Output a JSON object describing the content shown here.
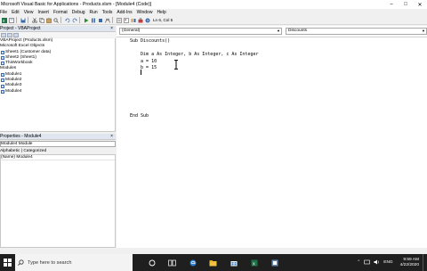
{
  "window": {
    "title": "Microsoft Visual Basic for Applications - Products.xlsm - [Module4 (Code)]",
    "controls": [
      "–",
      "□",
      "✕"
    ]
  },
  "menu": [
    "File",
    "Edit",
    "View",
    "Insert",
    "Format",
    "Debug",
    "Run",
    "Tools",
    "Add-Ins",
    "Window",
    "Help"
  ],
  "toolbar": {
    "position": "Ln 6, Col 5"
  },
  "project_pane": {
    "title": "Project - VBAProject",
    "close": "×",
    "tree": [
      "VBAProject (Products.xlsm)",
      "Microsoft Excel Objects",
      "Sheet1 (Customer data)",
      "Sheet2 (Sheet1)",
      "ThisWorkbook",
      "Modules",
      "Module1",
      "Module2",
      "Module3",
      "Module4"
    ]
  },
  "properties_pane": {
    "title": "Properties - Module4",
    "close": "×",
    "object": "Module4 Module",
    "tab": "Alphabetic | Categorized",
    "rows": [
      "(Name)  Module4"
    ]
  },
  "code": {
    "object_combo": "(General)",
    "proc_combo": "Discounts",
    "lines": [
      "Sub Discounts()",
      "",
      "    Dim a As Integer, b As Integer, c As Integer",
      "    a = 10",
      "    b = 15",
      "    ",
      "",
      "",
      "",
      "",
      "",
      "End Sub"
    ]
  },
  "taskbar": {
    "search_placeholder": "Type here to search",
    "language": "ENG",
    "time": "9:59 AM",
    "date": "4/22/2020"
  },
  "colors": {
    "taskbar": "#1f1f1f",
    "pane_header": "#dfe6f0",
    "editor_bg": "#ffffff"
  }
}
